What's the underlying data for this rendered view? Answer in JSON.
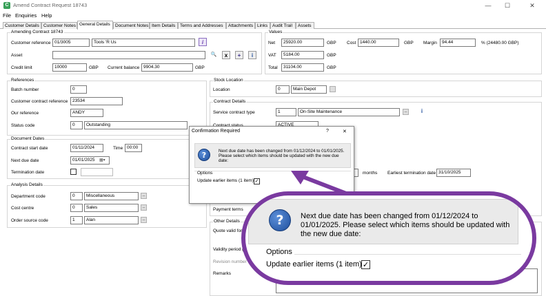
{
  "window": {
    "title": "Amend Contract Request 18743",
    "app_icon_glyph": "C",
    "minimize_glyph": "—",
    "maximize_glyph": "☐",
    "close_glyph": "✕"
  },
  "menu": [
    "File",
    "Enquiries",
    "Help"
  ],
  "tabs": [
    {
      "label": "Customer Details"
    },
    {
      "label": "Customer Notes"
    },
    {
      "label": "General Details",
      "active": true
    },
    {
      "label": "Document Notes"
    },
    {
      "label": "Item Details"
    },
    {
      "label": "Terms and Addresses"
    },
    {
      "label": "Attachments"
    },
    {
      "label": "Links"
    },
    {
      "label": "Audit Trail"
    },
    {
      "label": "Assets"
    }
  ],
  "amending": {
    "title": "Amending Contract 18743",
    "customer_reference_label": "Customer reference",
    "customer_reference_code": "01/3005",
    "customer_reference_name": "Tools 'R Us",
    "asset_label": "Asset",
    "asset_value": "",
    "credit_limit_label": "Credit limit",
    "credit_limit": "10000",
    "credit_currency": "GBP",
    "current_balance_label": "Current balance",
    "current_balance": "9904.30",
    "balance_currency": "GBP",
    "asset_buttons": {
      "search": "🔍",
      "clear": "x",
      "add": "+",
      "info": "i"
    },
    "customer_info_icon": "i"
  },
  "values": {
    "title": "Values",
    "net_label": "Net",
    "net": "25920.00",
    "net_currency": "GBP",
    "cost_label": "Cost",
    "cost": "1440.00",
    "cost_currency": "GBP",
    "margin_label": "Margin",
    "margin": "94.44",
    "margin_suffix": "% (24480.00 GBP)",
    "vat_label": "VAT",
    "vat": "5184.00",
    "vat_currency": "GBP",
    "total_label": "Total",
    "total": "31104.00",
    "total_currency": "GBP"
  },
  "references": {
    "title": "References",
    "batch_number_label": "Batch number",
    "batch_number": "0",
    "customer_contract_reference_label": "Customer contract reference",
    "customer_contract_reference": "23534",
    "our_reference_label": "Our reference",
    "our_reference": "ANDY",
    "status_code_label": "Status code",
    "status_code": "0",
    "status_text": "Outstanding"
  },
  "document_dates": {
    "title": "Document Dates",
    "contract_start_date_label": "Contract start date",
    "contract_start_date": "01/11/2024",
    "time_label": "Time",
    "time": "00:00",
    "next_due_date_label": "Next due date",
    "next_due_date": "01/01/2025",
    "termination_date_label": "Termination date",
    "calendar_glyph": "▦▾"
  },
  "analysis": {
    "title": "Analysis Details",
    "department_code_label": "Department code",
    "department_code": "0",
    "department_name": "Miscellaneous",
    "cost_centre_label": "Cost centre",
    "cost_centre": "0",
    "cost_centre_name": "Sales",
    "order_source_code_label": "Order source code",
    "order_source_code": "1",
    "order_source_name": "Alan",
    "ellipsis": "..."
  },
  "stock_location": {
    "title": "Stock Location",
    "location_label": "Location",
    "location_code": "0",
    "location_name": "Main Depot"
  },
  "contract_details": {
    "title": "Contract Details",
    "service_contract_type_label": "Service contract type",
    "service_contract_type_code": "1",
    "service_contract_type_name": "On-Site Maintenance",
    "contract_status_label": "Contract status",
    "contract_status": "ACTIVE",
    "months_label": "months",
    "earliest_termination_date_label": "Earliest termination date",
    "earliest_termination_date": "31/10/2025",
    "payment_terms_label": "Payment terms",
    "ellipsis": "...",
    "info_icon": "i"
  },
  "other_details": {
    "title": "Other Details",
    "quote_valid_for_label": "Quote valid for",
    "validity_period_label": "Validity period (day",
    "revision_number_label": "Revision number",
    "remarks_label": "Remarks"
  },
  "dialog": {
    "title": "Confirmation Required",
    "help_glyph": "?",
    "close_glyph": "✕",
    "question_glyph": "?",
    "message": "Next due date has been changed from 01/12/2024 to 01/01/2025. Please select which items should be updated with the new due date:",
    "options_label": "Options",
    "option_update_earlier": "Update earlier items (1 item)",
    "option_checked": true,
    "check_glyph": "✓"
  },
  "colors": {
    "callout_purple": "#7a3aa0",
    "question_blue": "#1e4e9c",
    "info_purple": "#6b3fb0"
  }
}
